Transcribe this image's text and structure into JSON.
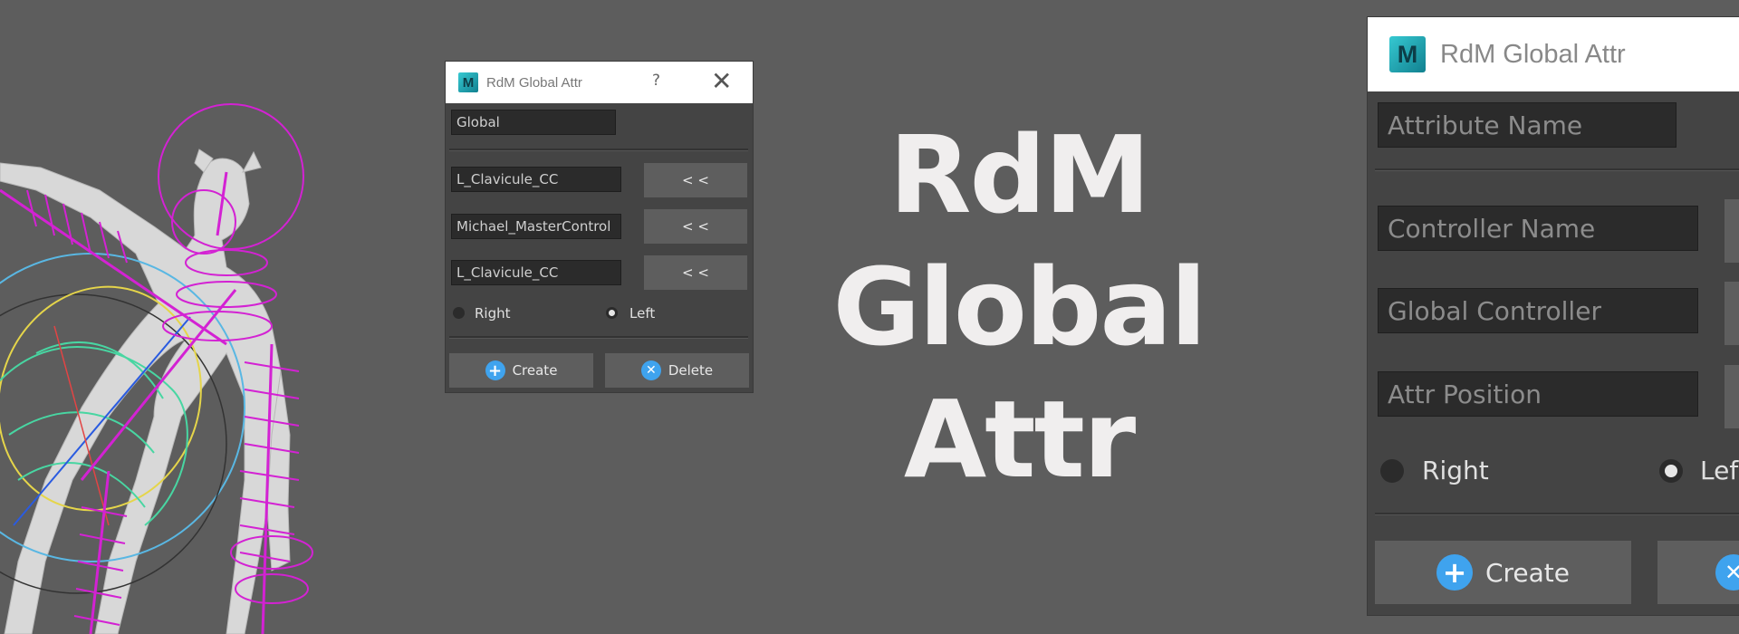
{
  "hero": {
    "line1": "RdM",
    "line2": "Global",
    "line3": "Attr"
  },
  "small_dialog": {
    "title": "RdM Global Attr",
    "logo": "M",
    "help": "?",
    "close": "✕",
    "attribute_value": "Global",
    "controller_value": "L_Clavicule_CC",
    "global_controller_value": "Michael_MasterControl",
    "attr_position_value": "L_Clavicule_CC",
    "pick_label": "< <",
    "radio_right": "Right",
    "radio_left": "Left",
    "create": "Create",
    "delete": "Delete"
  },
  "large_dialog": {
    "title": "RdM Global Attr",
    "logo": "M",
    "attribute_placeholder": "Attribute Name",
    "controller_placeholder": "Controller Name",
    "global_controller_placeholder": "Global Controller",
    "attr_position_placeholder": "Attr Position",
    "radio_right": "Right",
    "radio_left": "Lef",
    "create": "Create"
  },
  "colors": {
    "background": "#5d5d5d",
    "dialog_body": "#444444",
    "field": "#2b2b2b",
    "button": "#5e5e5e",
    "rig_magenta": "#e01ee0",
    "accent_blue": "#3fa3ee"
  }
}
